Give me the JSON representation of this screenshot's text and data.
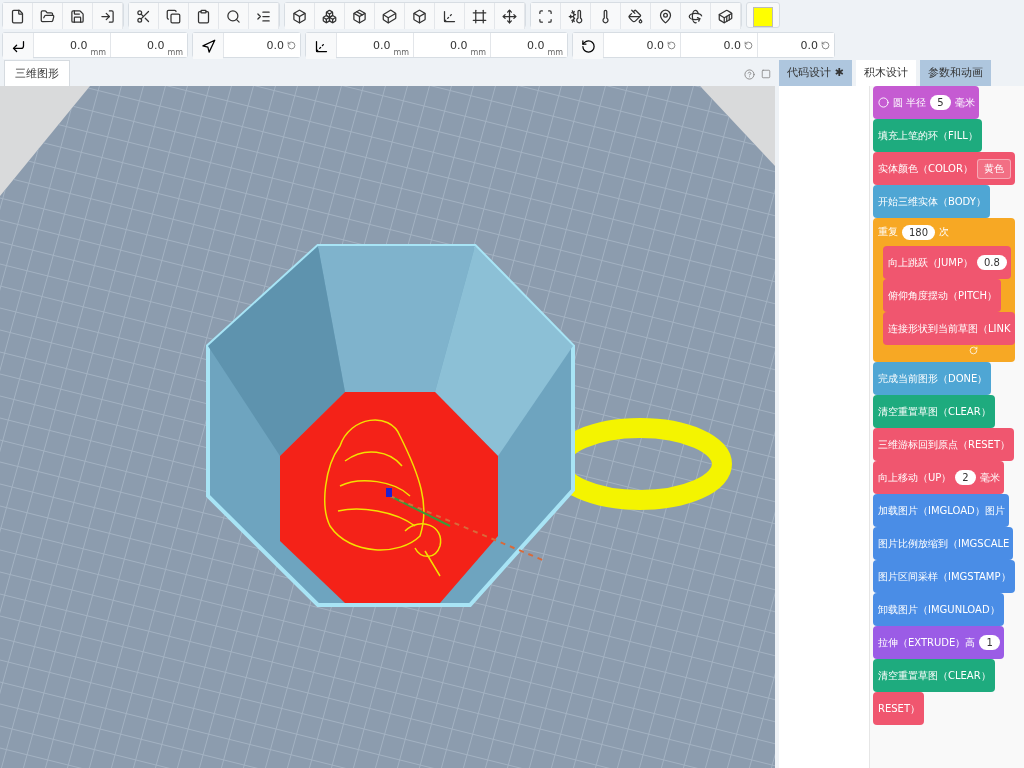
{
  "coordinates": [
    {
      "kind": "move",
      "fields": [
        {
          "value": "0.0",
          "unit": "mm"
        },
        {
          "value": "0.0",
          "unit": "mm"
        }
      ]
    },
    {
      "kind": "direction",
      "fields": [
        {
          "value": "0.0"
        }
      ]
    },
    {
      "kind": "axes",
      "fields": [
        {
          "value": "0.0",
          "unit": "mm"
        },
        {
          "value": "0.0",
          "unit": "mm"
        },
        {
          "value": "0.0",
          "unit": "mm"
        }
      ]
    },
    {
      "kind": "rotate",
      "fields": [
        {
          "value": "0.0"
        },
        {
          "value": "0.0"
        },
        {
          "value": "0.0"
        }
      ]
    }
  ],
  "viewport": {
    "tab": "三维图形"
  },
  "panel_tabs": [
    {
      "label": "代码设计 ✱",
      "selected": false
    },
    {
      "label": "积木设计",
      "selected": true
    },
    {
      "label": "参数和动画",
      "selected": false
    }
  ],
  "blocks": [
    {
      "color": "#c55bd2",
      "parts": [
        {
          "kind": "circle"
        },
        {
          "kind": "text",
          "text": "圆 半径"
        },
        {
          "kind": "input",
          "text": "5"
        },
        {
          "kind": "text",
          "text": "毫米"
        }
      ]
    },
    {
      "color": "#1eab7e",
      "parts": [
        {
          "kind": "text",
          "text": "填充上笔的环（FILL）"
        }
      ]
    },
    {
      "color": "#f0566f",
      "parts": [
        {
          "kind": "text",
          "text": "实体颜色（COLOR）"
        },
        {
          "kind": "dropdown",
          "text": "黄色"
        }
      ]
    },
    {
      "color": "#4fa6d4",
      "parts": [
        {
          "kind": "text",
          "text": "开始三维实体（BODY）"
        }
      ]
    },
    {
      "color": "#f7a824",
      "parts": [
        {
          "kind": "text",
          "text": "重复"
        },
        {
          "kind": "input",
          "text": "180"
        },
        {
          "kind": "text",
          "text": "次"
        }
      ],
      "children": [
        {
          "color": "#f0566f",
          "parts": [
            {
              "kind": "text",
              "text": "向上跳跃（JUMP）"
            },
            {
              "kind": "input",
              "text": "0.8"
            }
          ]
        },
        {
          "color": "#f0566f",
          "parts": [
            {
              "kind": "text",
              "text": "俯仰角度摆动（PITCH）"
            }
          ]
        },
        {
          "color": "#f0566f",
          "parts": [
            {
              "kind": "text",
              "text": "连接形状到当前草图（LINK"
            }
          ]
        }
      ]
    },
    {
      "color": "#4fa6d4",
      "parts": [
        {
          "kind": "text",
          "text": "完成当前图形（DONE）"
        }
      ]
    },
    {
      "color": "#1eab7e",
      "parts": [
        {
          "kind": "text",
          "text": "清空重置草图（CLEAR）"
        }
      ]
    },
    {
      "color": "#f0566f",
      "parts": [
        {
          "kind": "text",
          "text": "三维游标回到原点（RESET）"
        }
      ]
    },
    {
      "color": "#f0566f",
      "parts": [
        {
          "kind": "text",
          "text": "向上移动（UP）"
        },
        {
          "kind": "input",
          "text": "2"
        },
        {
          "kind": "text",
          "text": "毫米"
        }
      ]
    },
    {
      "color": "#4a8de6",
      "parts": [
        {
          "kind": "text",
          "text": "加载图片（IMGLOAD）图片"
        }
      ]
    },
    {
      "color": "#4a8de6",
      "parts": [
        {
          "kind": "text",
          "text": "图片比例放缩到（IMGSCALE"
        }
      ]
    },
    {
      "color": "#4a8de6",
      "parts": [
        {
          "kind": "text",
          "text": "图片区间采样（IMGSTAMP）"
        }
      ]
    },
    {
      "color": "#4a8de6",
      "parts": [
        {
          "kind": "text",
          "text": "卸载图片（IMGUNLOAD）"
        }
      ]
    },
    {
      "color": "#9b5ce6",
      "parts": [
        {
          "kind": "text",
          "text": "拉伸（EXTRUDE）高"
        },
        {
          "kind": "input",
          "text": "1"
        }
      ]
    },
    {
      "color": "#1eab7e",
      "parts": [
        {
          "kind": "text",
          "text": "清空重置草图（CLEAR）"
        }
      ]
    },
    {
      "color": "#f0566f",
      "parts": [
        {
          "kind": "text",
          "text": "RESET）"
        }
      ]
    }
  ]
}
